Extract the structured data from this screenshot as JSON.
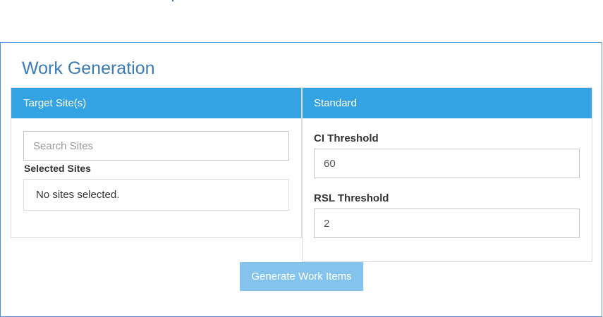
{
  "page": {
    "title": "Work Generation"
  },
  "target_sites": {
    "header": "Target Site(s)",
    "search_placeholder": "Search Sites",
    "search_value": "",
    "selected_label": "Selected Sites",
    "selected_empty_text": "No sites selected."
  },
  "standard": {
    "header": "Standard",
    "ci_threshold_label": "CI Threshold",
    "ci_threshold_value": "60",
    "rsl_threshold_label": "RSL Threshold",
    "rsl_threshold_value": "2"
  },
  "actions": {
    "generate_label": "Generate Work Items",
    "generate_enabled": false
  },
  "colors": {
    "accent": "#33a3e4",
    "title": "#3a7cb8",
    "button_disabled": "#84c4ec",
    "border": "#4a8fd0"
  }
}
